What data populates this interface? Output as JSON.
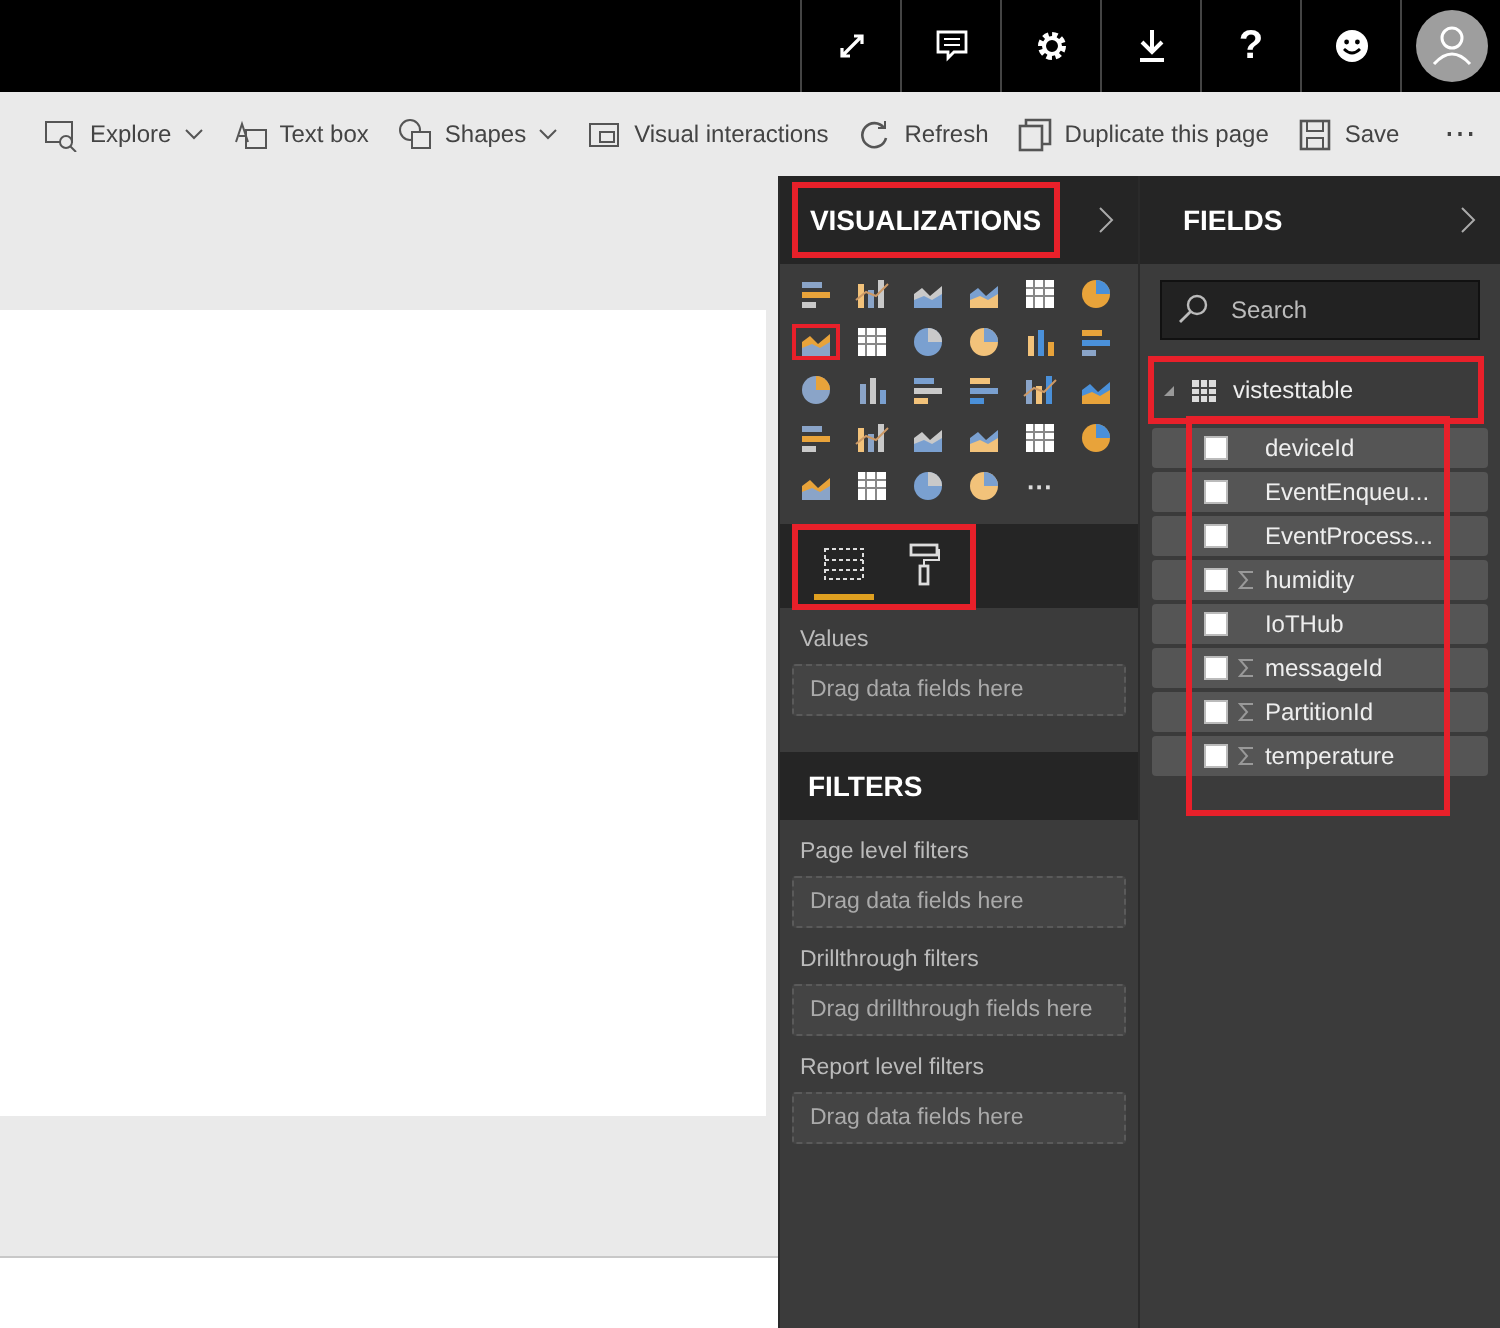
{
  "top_bar": {
    "help_label": "?"
  },
  "toolbar": {
    "items": [
      {
        "kind": "explore",
        "label": "Explore",
        "dropdown": true
      },
      {
        "kind": "textbox",
        "label": "Text box",
        "dropdown": false
      },
      {
        "kind": "shapes",
        "label": "Shapes",
        "dropdown": true
      },
      {
        "kind": "interactions",
        "label": "Visual interactions",
        "dropdown": false
      },
      {
        "kind": "refresh",
        "label": "Refresh",
        "dropdown": false
      },
      {
        "kind": "duplicate",
        "label": "Duplicate this page",
        "dropdown": false
      },
      {
        "kind": "save",
        "label": "Save",
        "dropdown": false
      }
    ],
    "more_label": "⋯"
  },
  "visualizations": {
    "title": "VISUALIZATIONS",
    "highlighted": true,
    "visuals": [
      {
        "selected": false
      },
      {
        "selected": false
      },
      {
        "selected": false
      },
      {
        "selected": false
      },
      {
        "selected": false
      },
      {
        "selected": false
      },
      {
        "selected": true
      },
      {
        "selected": false
      },
      {
        "selected": false
      },
      {
        "selected": false
      },
      {
        "selected": false
      },
      {
        "selected": false
      },
      {
        "selected": false
      },
      {
        "selected": false
      },
      {
        "selected": false
      },
      {
        "selected": false
      },
      {
        "selected": false
      },
      {
        "selected": false
      },
      {
        "selected": false
      },
      {
        "selected": false
      },
      {
        "selected": false
      },
      {
        "selected": false
      },
      {
        "selected": false
      },
      {
        "selected": false
      },
      {
        "selected": false
      },
      {
        "selected": false
      },
      {
        "selected": false
      },
      {
        "selected": false
      }
    ],
    "more_label": "···",
    "tabs_highlighted": true,
    "tabs": [
      {
        "kind": "fields",
        "selected": true
      },
      {
        "kind": "format",
        "selected": false
      }
    ],
    "wells": [
      {
        "label": "Values",
        "placeholder": "Drag data fields here"
      }
    ]
  },
  "filters": {
    "title": "FILTERS",
    "sections": [
      {
        "label": "Page level filters",
        "placeholder": "Drag data fields here"
      },
      {
        "label": "Drillthrough filters",
        "placeholder": "Drag drillthrough fields here"
      },
      {
        "label": "Report level filters",
        "placeholder": "Drag data fields here"
      }
    ]
  },
  "fields": {
    "title": "FIELDS",
    "search": {
      "placeholder": "Search"
    },
    "tables": [
      {
        "name": "vistesttable",
        "expanded": true,
        "highlighted": true,
        "fields_highlighted": true,
        "children": [
          {
            "name": "deviceId",
            "checked": false,
            "sum": false
          },
          {
            "name": "EventEnqueu...",
            "checked": false,
            "sum": false
          },
          {
            "name": "EventProcess...",
            "checked": false,
            "sum": false
          },
          {
            "name": "humidity",
            "checked": false,
            "sum": true
          },
          {
            "name": "IoTHub",
            "checked": false,
            "sum": false
          },
          {
            "name": "messageId",
            "checked": false,
            "sum": true
          },
          {
            "name": "PartitionId",
            "checked": false,
            "sum": true
          },
          {
            "name": "temperature",
            "checked": false,
            "sum": true
          }
        ]
      }
    ]
  }
}
